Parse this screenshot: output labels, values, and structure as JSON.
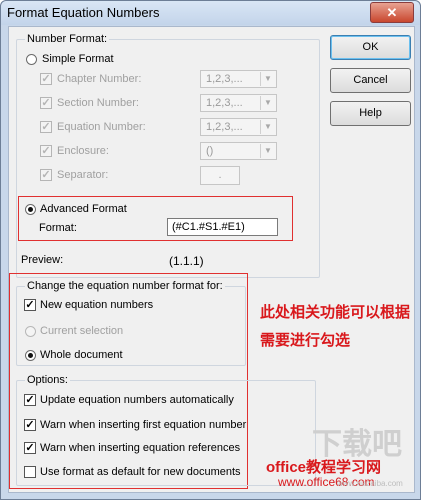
{
  "window": {
    "title": "Format Equation Numbers",
    "close_glyph": "✕"
  },
  "number_format": {
    "legend": "Number Format:",
    "simple_format": {
      "label": "Simple Format",
      "selected": false
    },
    "rows": [
      {
        "label": "Chapter Number:",
        "checked": true,
        "value": "1,2,3,..."
      },
      {
        "label": "Section Number:",
        "checked": true,
        "value": "1,2,3,..."
      },
      {
        "label": "Equation Number:",
        "checked": true,
        "value": "1,2,3,..."
      },
      {
        "label": "Enclosure:",
        "checked": true,
        "value": "()"
      },
      {
        "label": "Separator:",
        "checked": true,
        "value": "."
      }
    ],
    "advanced_format": {
      "label": "Advanced Format",
      "selected": true,
      "format_label": "Format:",
      "format_value": "(#C1.#S1.#E1)"
    },
    "preview_label": "Preview:",
    "preview_value": "(1.1.1)"
  },
  "change_for": {
    "legend": "Change the equation number format for:",
    "new_equations": {
      "label": "New equation numbers",
      "checked": true
    },
    "current_selection": {
      "label": "Current selection",
      "selected": false
    },
    "whole_document": {
      "label": "Whole document",
      "selected": true
    }
  },
  "options": {
    "legend": "Options:",
    "items": [
      {
        "label": "Update equation numbers automatically",
        "checked": true
      },
      {
        "label": "Warn when inserting first equation number",
        "checked": true
      },
      {
        "label": "Warn when inserting equation references",
        "checked": true
      },
      {
        "label": "Use format as default for new documents",
        "checked": false
      }
    ]
  },
  "buttons": {
    "ok": "OK",
    "cancel": "Cancel",
    "help": "Help"
  },
  "annotation": {
    "line1": "此处相关功能可以根据",
    "line2": "需要进行勾选"
  },
  "watermark": {
    "site_name": "office教程学习网",
    "url": "www.office68.com",
    "logo_text": "下载吧",
    "url2": "www.xiazaiba.com"
  },
  "colors": {
    "accent_red": "#e03030",
    "dialog_bg": "#f0f0f0",
    "frame": "#c8d7ea"
  }
}
